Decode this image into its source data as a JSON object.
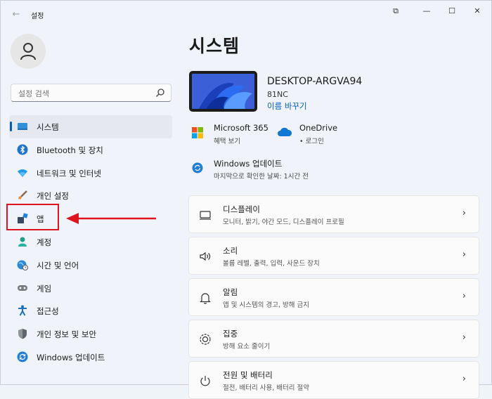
{
  "window": {
    "app_title": "설정",
    "back_icon": "←",
    "controls": {
      "snap": "⧉",
      "minimize": "—",
      "maximize": "☐",
      "close": "✕"
    }
  },
  "search": {
    "placeholder": "설정 검색"
  },
  "sidebar": {
    "items": [
      {
        "label": "시스템",
        "icon": "system-icon",
        "selected": true
      },
      {
        "label": "Bluetooth 및 장치",
        "icon": "bluetooth-icon"
      },
      {
        "label": "네트워크 및 인터넷",
        "icon": "wifi-icon"
      },
      {
        "label": "개인 설정",
        "icon": "brush-icon"
      },
      {
        "label": "앱",
        "icon": "apps-icon"
      },
      {
        "label": "계정",
        "icon": "account-icon"
      },
      {
        "label": "시간 및 언어",
        "icon": "globe-clock-icon"
      },
      {
        "label": "게임",
        "icon": "gamepad-icon"
      },
      {
        "label": "접근성",
        "icon": "accessibility-icon"
      },
      {
        "label": "개인 정보 및 보안",
        "icon": "shield-icon"
      },
      {
        "label": "Windows 업데이트",
        "icon": "update-icon"
      }
    ]
  },
  "main": {
    "title": "시스템",
    "device": {
      "name": "DESKTOP-ARGVA94",
      "model": "81NC",
      "rename": "이름 바꾸기"
    },
    "tiles": [
      {
        "title": "Microsoft 365",
        "subtitle": "혜택 보기",
        "icon": "microsoft-logo-icon"
      },
      {
        "title": "OneDrive",
        "subtitle": "• 로그인",
        "icon": "onedrive-cloud-icon"
      },
      {
        "title": "Windows 업데이트",
        "subtitle": "마지막으로 확인한 날짜: 1시간 전",
        "icon": "update-icon"
      }
    ],
    "cards": [
      {
        "title": "디스플레이",
        "subtitle": "모니터, 밝기, 야간 모드, 디스플레이 프로필",
        "icon": "monitor-icon"
      },
      {
        "title": "소리",
        "subtitle": "볼륨 레벨, 출력, 입력, 사운드 장치",
        "icon": "speaker-icon"
      },
      {
        "title": "알림",
        "subtitle": "앱 및 시스템의 경고, 방해 금지",
        "icon": "bell-icon"
      },
      {
        "title": "집중",
        "subtitle": "방해 요소 줄이기",
        "icon": "focus-icon"
      },
      {
        "title": "전원 및 배터리",
        "subtitle": "절전, 배터리 사용, 배터리 절약",
        "icon": "power-icon"
      }
    ]
  },
  "colors": {
    "accent": "#005fb8",
    "annotation": "#e0141e"
  }
}
